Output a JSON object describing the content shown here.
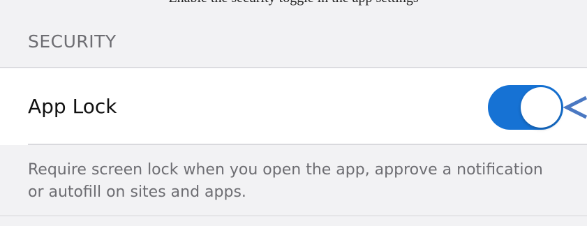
{
  "top_caption": "Enable the security toggle in the app settings",
  "section": {
    "title": "SECURITY"
  },
  "app_lock": {
    "label": "App Lock",
    "toggle_on": true,
    "accent_color": "#1672d4",
    "annotation_color": "#4a78c2"
  },
  "footer": {
    "description": "Require screen lock when you open the app, approve a notification or autofill on sites and apps."
  }
}
